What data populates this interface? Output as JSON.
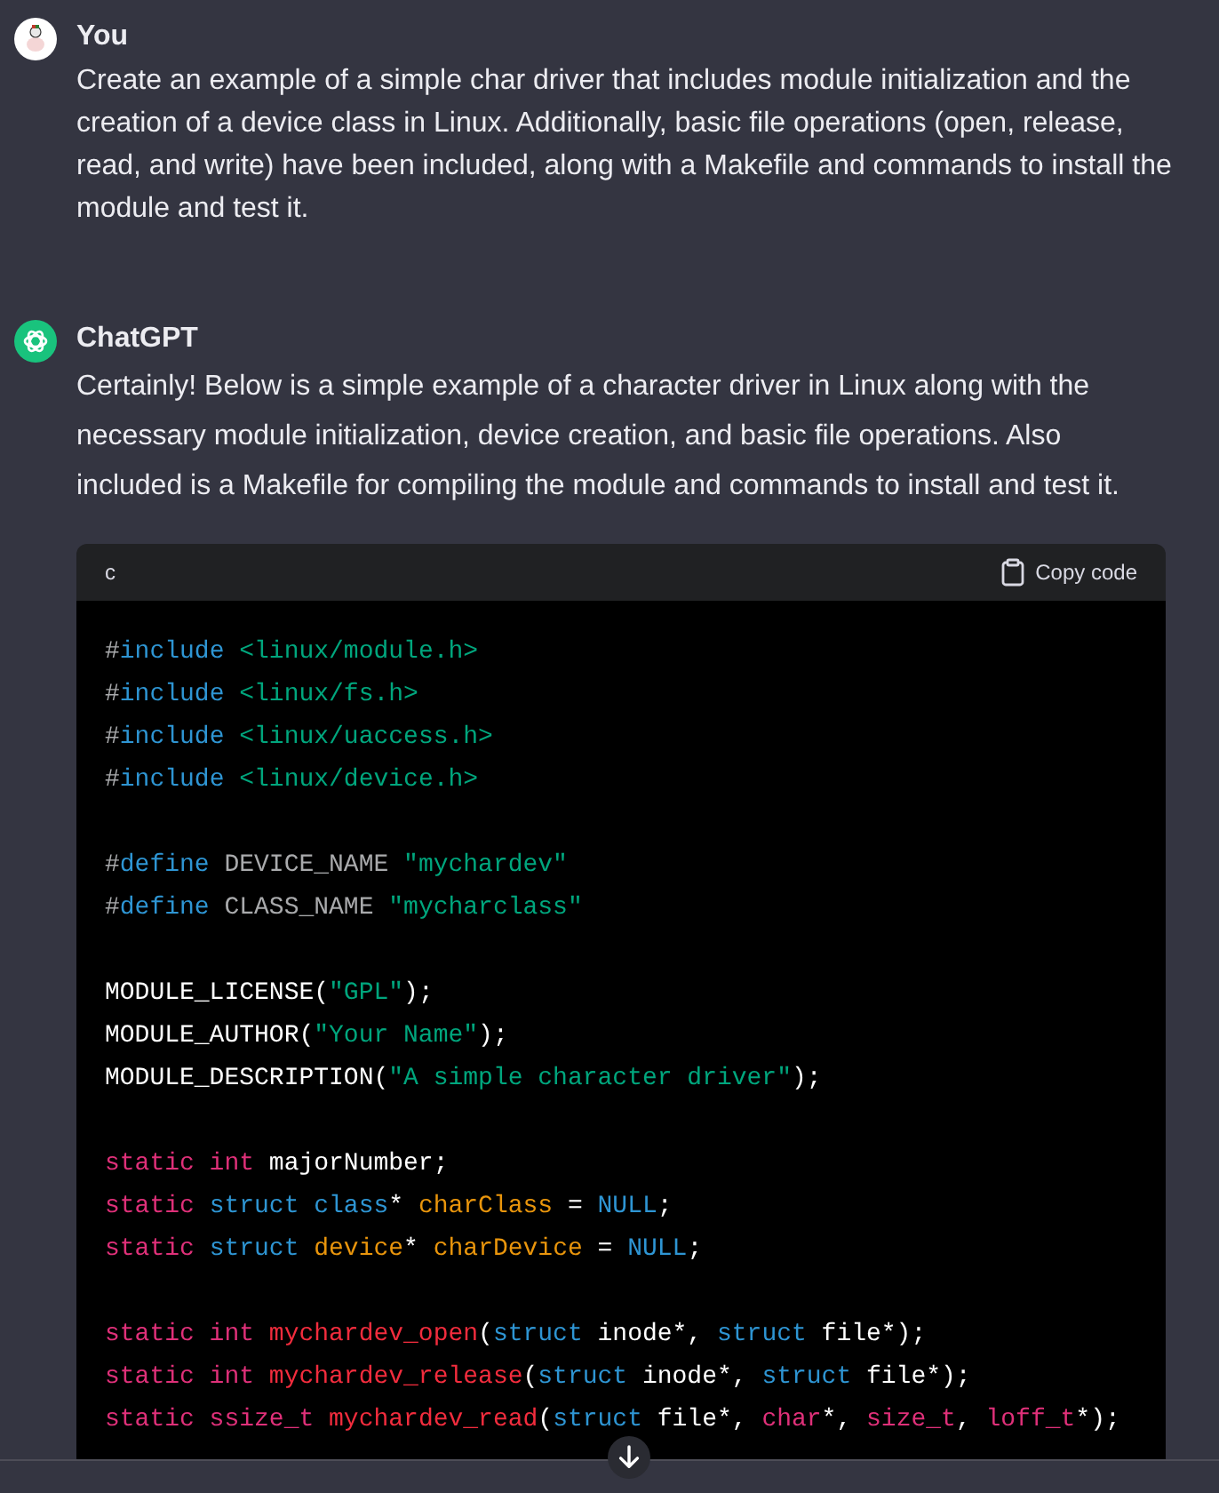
{
  "messages": [
    {
      "kind": "user",
      "author": "You",
      "text": "Create an example of a simple char driver that includes module initialization and the creation of a device class in Linux. Additionally, basic file operations (open, release, read, and write) have been included, along with a Makefile and commands to install the module and test it."
    },
    {
      "kind": "assistant",
      "author": "ChatGPT",
      "text": "Certainly! Below is a simple example of a character driver in Linux along with the necessary module initialization, device creation, and basic file operations. Also included is a Makefile for compiling the module and commands to install and test it.",
      "code": {
        "language": "c",
        "copy_label": "Copy code",
        "blocks": [
          [
            [
              {
                "color": "#a9aaac",
                "t": "#"
              },
              {
                "color": "#2e95d3",
                "t": "include "
              },
              {
                "color": "#00a67d",
                "t": "<linux/module.h>"
              }
            ],
            [
              {
                "color": "#a9aaac",
                "t": "#"
              },
              {
                "color": "#2e95d3",
                "t": "include "
              },
              {
                "color": "#00a67d",
                "t": "<linux/fs.h>"
              }
            ],
            [
              {
                "color": "#a9aaac",
                "t": "#"
              },
              {
                "color": "#2e95d3",
                "t": "include "
              },
              {
                "color": "#00a67d",
                "t": "<linux/uaccess.h>"
              }
            ],
            [
              {
                "color": "#a9aaac",
                "t": "#"
              },
              {
                "color": "#2e95d3",
                "t": "include "
              },
              {
                "color": "#00a67d",
                "t": "<linux/device.h>"
              }
            ]
          ],
          [
            [
              {
                "color": "#a9aaac",
                "t": "#"
              },
              {
                "color": "#2e95d3",
                "t": "define "
              },
              {
                "color": "#a9aaac",
                "t": "DEVICE_NAME "
              },
              {
                "color": "#00a67d",
                "t": "\"mychardev\""
              }
            ],
            [
              {
                "color": "#a9aaac",
                "t": "#"
              },
              {
                "color": "#2e95d3",
                "t": "define "
              },
              {
                "color": "#a9aaac",
                "t": "CLASS_NAME "
              },
              {
                "color": "#00a67d",
                "t": "\"mycharclass\""
              }
            ]
          ],
          [
            [
              {
                "color": "#ffffff",
                "t": "MODULE_LICENSE("
              },
              {
                "color": "#00a67d",
                "t": "\"GPL\""
              },
              {
                "color": "#ffffff",
                "t": ");"
              }
            ],
            [
              {
                "color": "#ffffff",
                "t": "MODULE_AUTHOR("
              },
              {
                "color": "#00a67d",
                "t": "\"Your Name\""
              },
              {
                "color": "#ffffff",
                "t": ");"
              }
            ],
            [
              {
                "color": "#ffffff",
                "t": "MODULE_DESCRIPTION("
              },
              {
                "color": "#00a67d",
                "t": "\"A simple character driver\""
              },
              {
                "color": "#ffffff",
                "t": ");"
              }
            ]
          ],
          [
            [
              {
                "color": "#df3079",
                "t": "static int "
              },
              {
                "color": "#ffffff",
                "t": "majorNumber;"
              }
            ],
            [
              {
                "color": "#df3079",
                "t": "static "
              },
              {
                "color": "#2e95d3",
                "t": "struct class"
              },
              {
                "color": "#ffffff",
                "t": "* "
              },
              {
                "color": "#e9950c",
                "t": "charClass "
              },
              {
                "color": "#ffffff",
                "t": "= "
              },
              {
                "color": "#2e95d3",
                "t": "NULL"
              },
              {
                "color": "#ffffff",
                "t": ";"
              }
            ],
            [
              {
                "color": "#df3079",
                "t": "static "
              },
              {
                "color": "#2e95d3",
                "t": "struct "
              },
              {
                "color": "#e9950c",
                "t": "device"
              },
              {
                "color": "#ffffff",
                "t": "* "
              },
              {
                "color": "#e9950c",
                "t": "charDevice "
              },
              {
                "color": "#ffffff",
                "t": "= "
              },
              {
                "color": "#2e95d3",
                "t": "NULL"
              },
              {
                "color": "#ffffff",
                "t": ";"
              }
            ]
          ],
          [
            [
              {
                "color": "#df3079",
                "t": "static int "
              },
              {
                "color": "#f22c3d",
                "t": "mychardev_open"
              },
              {
                "color": "#ffffff",
                "t": "("
              },
              {
                "color": "#2e95d3",
                "t": "struct "
              },
              {
                "color": "#ffffff",
                "t": "inode*, "
              },
              {
                "color": "#2e95d3",
                "t": "struct "
              },
              {
                "color": "#ffffff",
                "t": "file*);"
              }
            ],
            [
              {
                "color": "#df3079",
                "t": "static int "
              },
              {
                "color": "#f22c3d",
                "t": "mychardev_release"
              },
              {
                "color": "#ffffff",
                "t": "("
              },
              {
                "color": "#2e95d3",
                "t": "struct "
              },
              {
                "color": "#ffffff",
                "t": "inode*, "
              },
              {
                "color": "#2e95d3",
                "t": "struct "
              },
              {
                "color": "#ffffff",
                "t": "file*);"
              }
            ],
            [
              {
                "color": "#df3079",
                "t": "static ssize_t "
              },
              {
                "color": "#f22c3d",
                "t": "mychardev_read"
              },
              {
                "color": "#ffffff",
                "t": "("
              },
              {
                "color": "#2e95d3",
                "t": "struct "
              },
              {
                "color": "#ffffff",
                "t": "file*, "
              },
              {
                "color": "#df3079",
                "t": "char"
              },
              {
                "color": "#ffffff",
                "t": "*, "
              },
              {
                "color": "#df3079",
                "t": "size_t"
              },
              {
                "color": "#ffffff",
                "t": ", "
              },
              {
                "color": "#df3079",
                "t": "loff_t"
              },
              {
                "color": "#ffffff",
                "t": "*);"
              }
            ]
          ]
        ]
      }
    }
  ]
}
